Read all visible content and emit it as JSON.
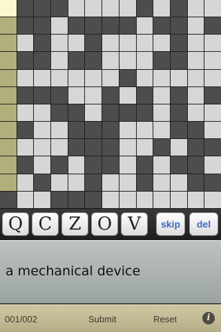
{
  "grid": {
    "rows": [
      "SDDDLLLLDLDLL",
      "CDDLDDDDLDDLD",
      "CLDLLDLLLLDLL",
      "CDDLDDLLLDDLL",
      "CLLLLLLDLLLLL",
      "CDDDLLDLDLDLD",
      "CLLDDLDDDLDLL",
      "CDLLDDDLLLDDL",
      "CLLLDDDLLDLDD",
      "CDLDLDDLDLDDL",
      "CLDLLDLLDLLDD",
      "DLLDDDLLLLLLL"
    ],
    "legend": {
      "D": "dark",
      "L": "light",
      "C": "clue",
      "S": "sel"
    },
    "colors": {
      "dark": "#4d4d4d",
      "light": "#d6d6d6",
      "clue": "#b2b07a",
      "sel": "#fbf8cf"
    }
  },
  "keys": {
    "letters": [
      "Q",
      "C",
      "Z",
      "O",
      "V"
    ],
    "skip_label": "skip",
    "del_label": "del",
    "action_color": "#3d6cc0"
  },
  "clue": {
    "text": "a mechanical device"
  },
  "footer": {
    "progress": "001/002",
    "submit_label": "Submit",
    "reset_label": "Reset",
    "info_icon": "info-icon"
  }
}
